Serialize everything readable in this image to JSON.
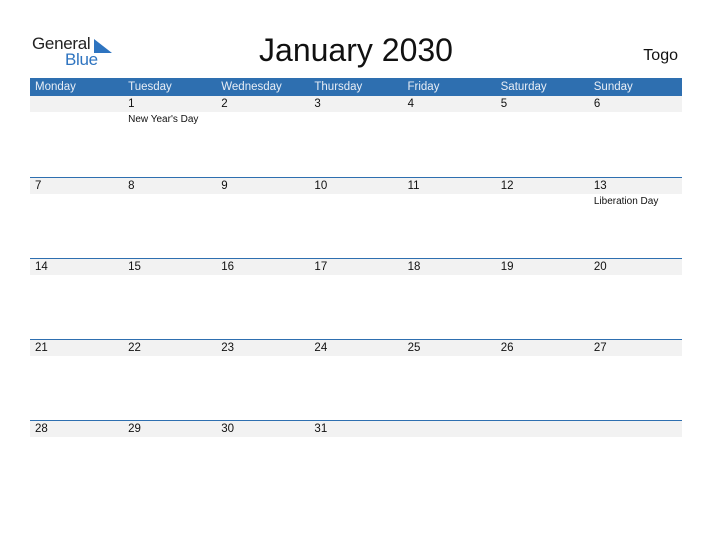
{
  "logo": {
    "word1": "General",
    "word2": "Blue",
    "icon": "triangle-flag-icon",
    "color": "#2e74c0"
  },
  "title": "January 2030",
  "country": "Togo",
  "colors": {
    "header_bg": "#2e6fb0",
    "row_band": "#f2f2f2"
  },
  "weekdays": [
    "Monday",
    "Tuesday",
    "Wednesday",
    "Thursday",
    "Friday",
    "Saturday",
    "Sunday"
  ],
  "weeks": [
    {
      "days": [
        {
          "d": ""
        },
        {
          "d": "1",
          "holiday": "New Year's Day"
        },
        {
          "d": "2"
        },
        {
          "d": "3"
        },
        {
          "d": "4"
        },
        {
          "d": "5"
        },
        {
          "d": "6"
        }
      ]
    },
    {
      "days": [
        {
          "d": "7"
        },
        {
          "d": "8"
        },
        {
          "d": "9"
        },
        {
          "d": "10"
        },
        {
          "d": "11"
        },
        {
          "d": "12"
        },
        {
          "d": "13",
          "holiday": "Liberation Day"
        }
      ]
    },
    {
      "days": [
        {
          "d": "14"
        },
        {
          "d": "15"
        },
        {
          "d": "16"
        },
        {
          "d": "17"
        },
        {
          "d": "18"
        },
        {
          "d": "19"
        },
        {
          "d": "20"
        }
      ]
    },
    {
      "days": [
        {
          "d": "21"
        },
        {
          "d": "22"
        },
        {
          "d": "23"
        },
        {
          "d": "24"
        },
        {
          "d": "25"
        },
        {
          "d": "26"
        },
        {
          "d": "27"
        }
      ]
    },
    {
      "days": [
        {
          "d": "28"
        },
        {
          "d": "29"
        },
        {
          "d": "30"
        },
        {
          "d": "31"
        },
        {
          "d": ""
        },
        {
          "d": ""
        },
        {
          "d": ""
        }
      ]
    }
  ]
}
